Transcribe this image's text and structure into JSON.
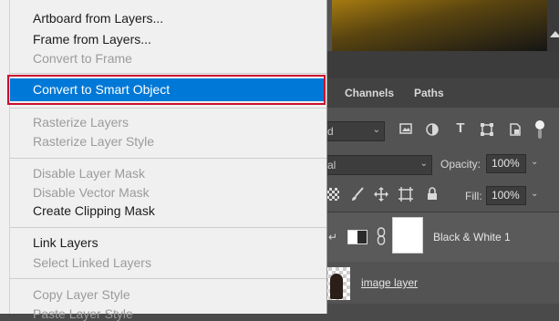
{
  "menu": {
    "items": [
      {
        "label": "Artboard from Layers...",
        "enabled": true
      },
      {
        "label": "Frame from Layers...",
        "enabled": true
      },
      {
        "label": "Convert to Frame",
        "enabled": false
      },
      {
        "label": "Convert to Smart Object",
        "enabled": true,
        "selected": true
      },
      {
        "label": "Rasterize Layers",
        "enabled": false
      },
      {
        "label": "Rasterize Layer Style",
        "enabled": false
      },
      {
        "label": "Disable Layer Mask",
        "enabled": false
      },
      {
        "label": "Disable Vector Mask",
        "enabled": false
      },
      {
        "label": "Create Clipping Mask",
        "enabled": true
      },
      {
        "label": "Link Layers",
        "enabled": true
      },
      {
        "label": "Select Linked Layers",
        "enabled": false
      },
      {
        "label": "Copy Layer Style",
        "enabled": false
      },
      {
        "label": "Paste Layer Style",
        "enabled": false
      }
    ],
    "highlight_color": "#0078d7",
    "annotation_color": "#c8102e"
  },
  "panel": {
    "tabs": [
      "Channels",
      "Paths"
    ],
    "kind_filter_value": "d",
    "blend_mode_value": "al",
    "opacity_label": "Opacity:",
    "opacity_value": "100%",
    "fill_label": "Fill:",
    "fill_value": "100%",
    "layers": [
      {
        "name": "Black & White 1"
      },
      {
        "name": "image layer"
      }
    ]
  },
  "icons": {
    "filter_icons": [
      "image-filter-icon",
      "adjustment-filter-icon",
      "type-filter-icon",
      "shape-filter-icon",
      "smart-object-filter-icon",
      "filter-toggle-icon"
    ],
    "lock_icons": [
      "lock-transparent-icon",
      "lock-paint-icon",
      "lock-position-icon",
      "lock-artboard-icon",
      "lock-all-icon"
    ]
  }
}
